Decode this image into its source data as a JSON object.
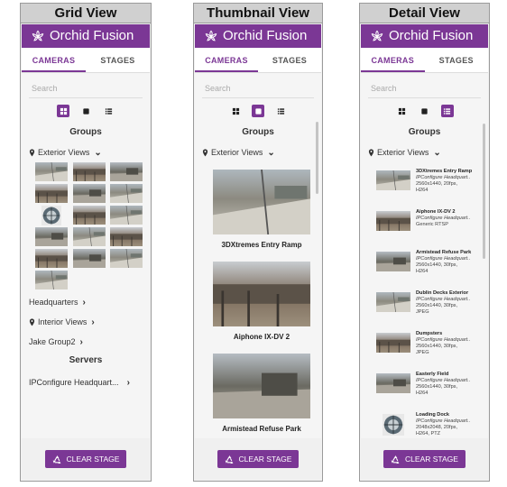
{
  "app": {
    "name": "Orchid Fusion",
    "search_placeholder": "Search",
    "clear_label": "CLEAR STAGE"
  },
  "tabs": {
    "cameras": "CAMERAS",
    "stages": "STAGES"
  },
  "colors": {
    "brand": "#7b3795",
    "panel_title_bg": "#d0d0d0"
  },
  "grid": {
    "title": "Grid View",
    "groups_heading": "Groups",
    "expanded_group": "Exterior Views",
    "other_groups": [
      "Headquarters",
      "Interior Views",
      "Jake Group2"
    ],
    "servers_heading": "Servers",
    "server": "IPConfigure Headquart..."
  },
  "thumbnail": {
    "title": "Thumbnail View",
    "groups_heading": "Groups",
    "expanded_group": "Exterior Views",
    "cameras": [
      "3DXtremes Entry Ramp",
      "Aiphone IX-DV 2",
      "Armistead Refuse Park"
    ]
  },
  "detail": {
    "title": "Detail View",
    "groups_heading": "Groups",
    "expanded_group": "Exterior Views",
    "cameras": [
      {
        "name": "3DXtremes Entry Ramp",
        "server": "IPConfigure Headquart..",
        "spec1": "2560x1440, 20fps,",
        "spec2": "H264"
      },
      {
        "name": "Aiphone IX-DV 2",
        "server": "IPConfigure Headquart..",
        "spec1": "Generic RTSP",
        "spec2": ""
      },
      {
        "name": "Armistead Refuse Park",
        "server": "IPConfigure Headquart..",
        "spec1": "2560x1440, 30fps,",
        "spec2": "H264"
      },
      {
        "name": "Dublin Decks Exterior",
        "server": "IPConfigure Headquart..",
        "spec1": "2560x1440, 30fps,",
        "spec2": "JPEG"
      },
      {
        "name": "Dumpsters",
        "server": "IPConfigure Headquart..",
        "spec1": "2560x1440, 30fps,",
        "spec2": "JPEG"
      },
      {
        "name": "Easterly Field",
        "server": "IPConfigure Headquart..",
        "spec1": "2560x1440, 30fps,",
        "spec2": "H264"
      },
      {
        "name": "Loading Dock",
        "server": "IPConfigure Headquart..",
        "spec1": "2048x2048, 20fps,",
        "spec2": "H264, PTZ"
      }
    ]
  }
}
